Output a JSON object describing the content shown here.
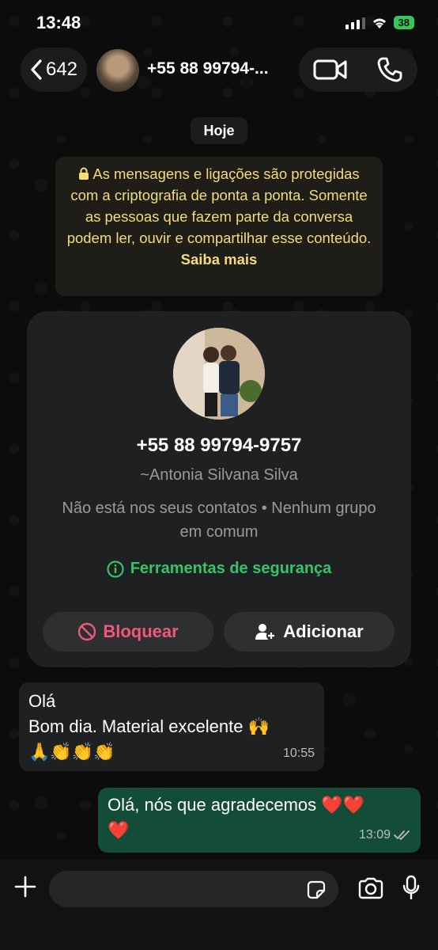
{
  "status_bar": {
    "time": "13:48",
    "battery": "38"
  },
  "header": {
    "back_count": "642",
    "contact_title": "+55 88 99794-...",
    "icons": {
      "back": "chevron-left-icon",
      "video": "video-camera-icon",
      "call": "phone-icon"
    }
  },
  "chat": {
    "day_label": "Hoje",
    "encryption_notice": {
      "text": "As mensagens e ligações são protegidas com a criptografia de ponta a ponta. Somente as pessoas que fazem parte da conversa podem ler, ouvir e compartilhar esse conteúdo.",
      "link": "Saiba mais"
    },
    "contact_card": {
      "phone": "+55 88 99794-9757",
      "name": "~Antonia Silvana Silva",
      "info": "Não está nos seus contatos • Nenhum grupo em comum",
      "safety_tools": "Ferramentas de segurança",
      "block_label": "Bloquear",
      "add_label": "Adicionar"
    },
    "messages": [
      {
        "direction": "incoming",
        "line1": "Olá",
        "line2": "Bom dia. Material excelente 🙌",
        "line3": "🙏👏👏👏",
        "time": "10:55"
      },
      {
        "direction": "outgoing",
        "line1": "Olá, nós que agradecemos ❤️❤️",
        "line2": "❤️",
        "time": "13:09",
        "status": "read"
      }
    ]
  },
  "composer": {
    "placeholder": ""
  },
  "colors": {
    "accent_green": "#35c46a",
    "danger_red": "#f0577a",
    "notice_yellow": "#f4dc7c",
    "outgoing_bubble": "#144d37"
  }
}
